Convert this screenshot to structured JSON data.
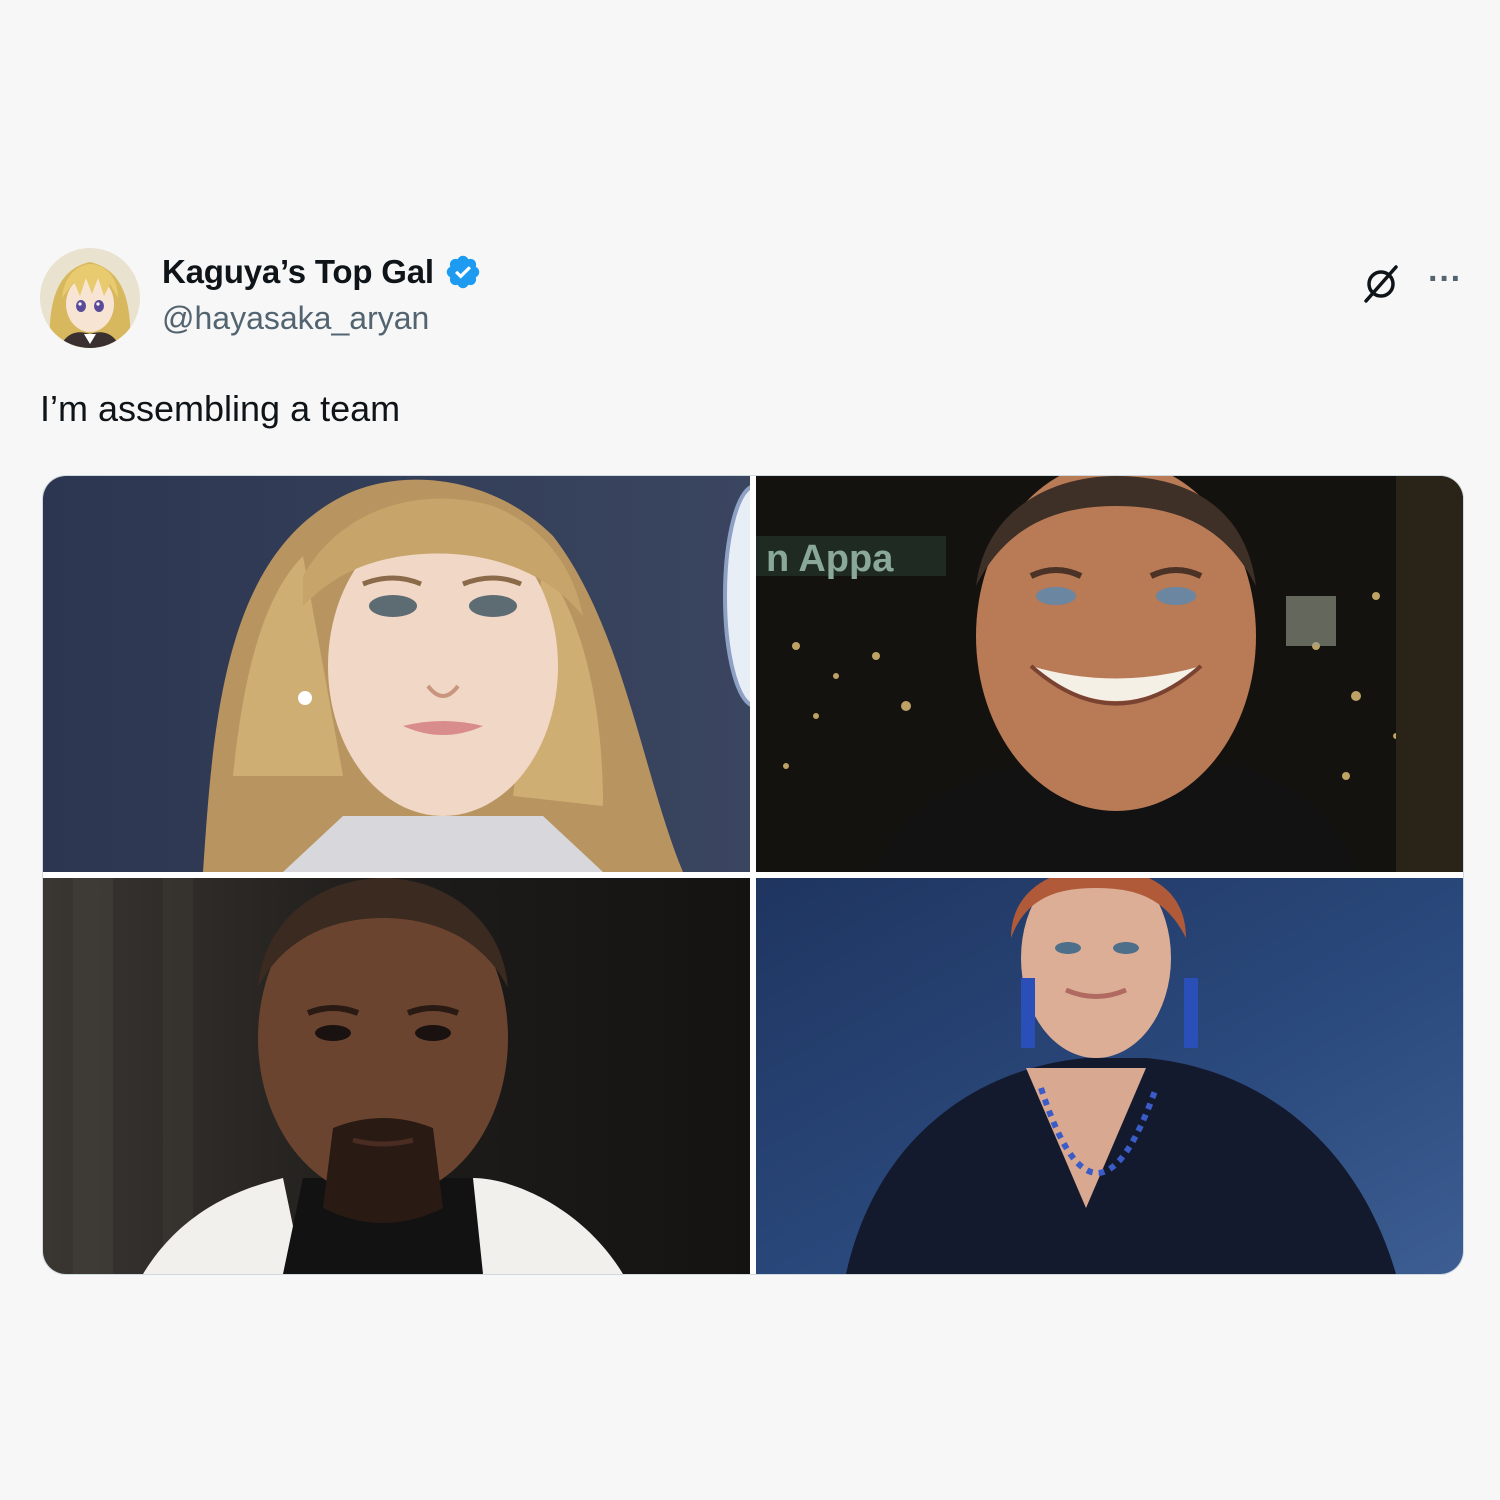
{
  "tweet": {
    "display_name": "Kaguya’s Top Gal",
    "handle": "@hayasaka_aryan",
    "text": "I’m assembling a team",
    "verified": true,
    "avatar_icon": "anime-avatar",
    "actions": {
      "grok_icon": "grok-icon",
      "more_label": "···"
    },
    "media": [
      {
        "name": "photo-1",
        "description_icon": "portrait-blonde-woman"
      },
      {
        "name": "photo-2",
        "description_icon": "portrait-smiling-man"
      },
      {
        "name": "photo-3",
        "description_icon": "portrait-bald-man"
      },
      {
        "name": "photo-4",
        "description_icon": "portrait-redhead-woman"
      }
    ]
  },
  "colors": {
    "background": "#f7f7f7",
    "text_primary": "#0f1419",
    "text_secondary": "#536471",
    "verified_blue": "#1d9bf0"
  }
}
